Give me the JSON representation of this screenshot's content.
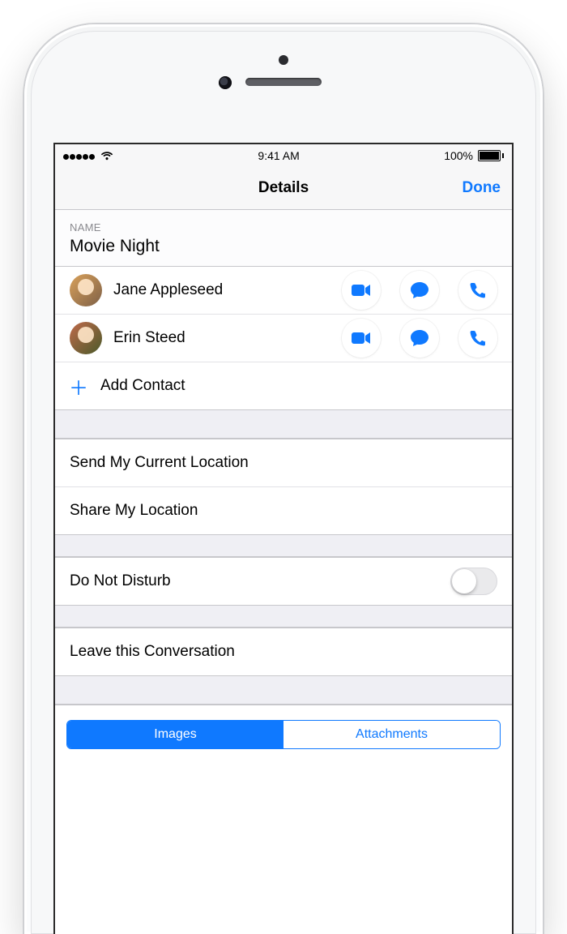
{
  "status": {
    "time": "9:41 AM",
    "battery": "100%"
  },
  "nav": {
    "title": "Details",
    "done": "Done"
  },
  "name_section": {
    "header": "NAME",
    "value": "Movie Night"
  },
  "contacts": [
    {
      "name": "Jane Appleseed"
    },
    {
      "name": "Erin Steed"
    }
  ],
  "add_contact": "Add Contact",
  "location": {
    "send": "Send My Current Location",
    "share": "Share My Location"
  },
  "dnd": {
    "label": "Do Not Disturb",
    "on": false
  },
  "leave": "Leave this Conversation",
  "segment": {
    "images": "Images",
    "attachments": "Attachments"
  }
}
